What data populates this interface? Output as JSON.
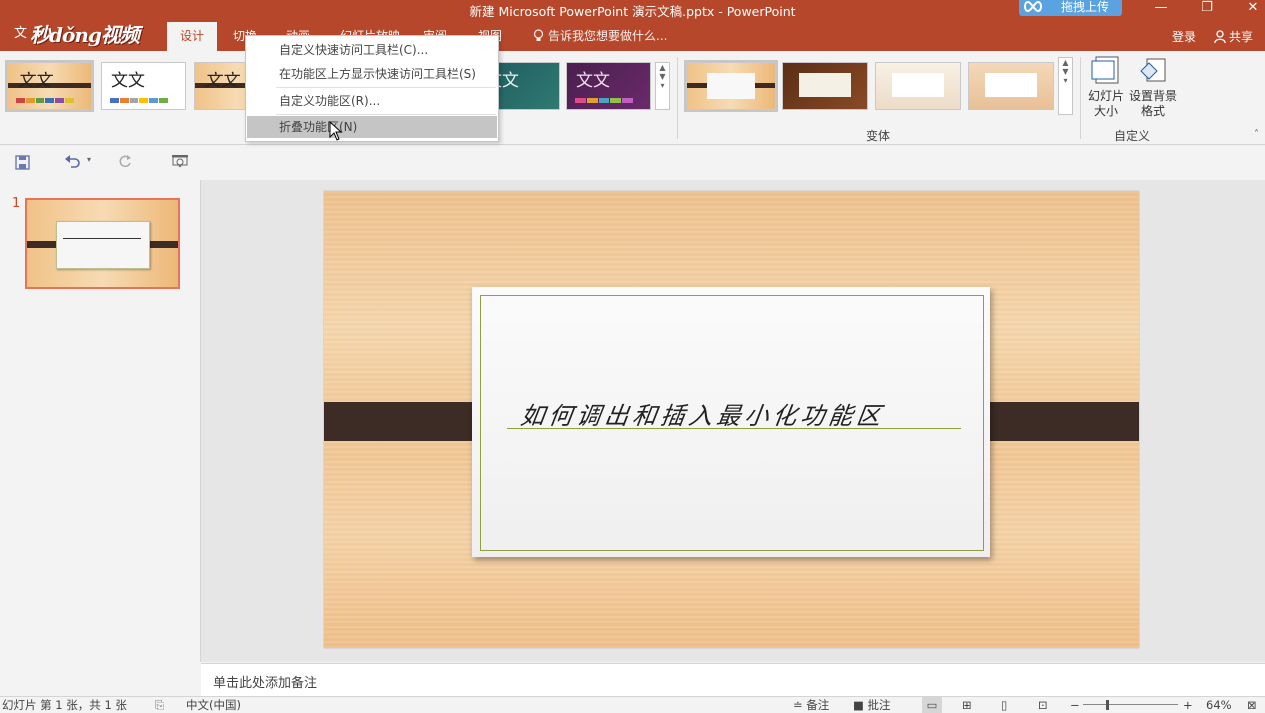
{
  "window": {
    "title": "新建 Microsoft PowerPoint 演示文稿.pptx - PowerPoint",
    "upload_label": "拖拽上传",
    "file_tab_partial": "文",
    "brand": "秒dǒng视频"
  },
  "tabs": [
    {
      "label": "设计",
      "active": true
    },
    {
      "label": "切换"
    },
    {
      "label": "动画"
    },
    {
      "label": "幻灯片放映"
    },
    {
      "label": "审阅"
    },
    {
      "label": "视图"
    }
  ],
  "tellme": "告诉我您想要做什么...",
  "account": {
    "signin": "登录",
    "share": "共享"
  },
  "ribbon": {
    "theme_sample_text": "文文",
    "variants_label": "变体",
    "customize_label": "自定义",
    "slide_size_label": "幻灯片大小",
    "bg_format_label": "设置背景格式"
  },
  "context_menu": {
    "items": [
      {
        "label": "自定义快速访问工具栏(C)..."
      },
      {
        "label": "在功能区上方显示快速访问工具栏(S)"
      },
      {
        "label": "自定义功能区(R)..."
      },
      {
        "label": "折叠功能区(N)",
        "hovered": true
      }
    ]
  },
  "thumbnail": {
    "number": "1"
  },
  "slide": {
    "title": "如何调出和插入最小化功能区"
  },
  "notes_placeholder": "单击此处添加备注",
  "status": {
    "slide_info": "幻灯片 第 1 张，共 1 张",
    "language": "中文(中国)",
    "notes": "备注",
    "comments": "批注",
    "zoom": "64%"
  },
  "colors": {
    "accent": "#b7472a",
    "band": "#3c2c25",
    "card_border": "#8da23c"
  }
}
